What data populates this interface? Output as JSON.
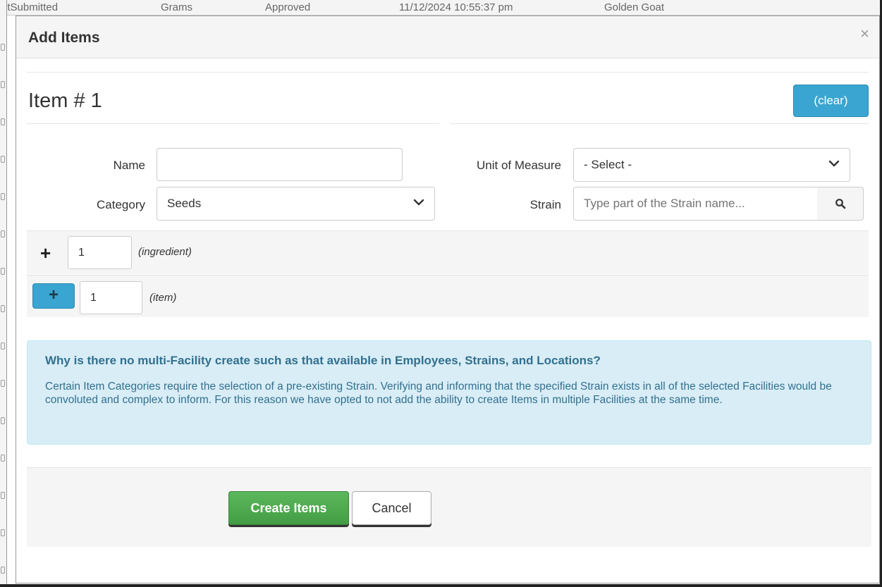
{
  "background": {
    "columns": [
      "otSubmitted",
      "Grams",
      "Approved",
      "11/12/2024 10:55:37 pm",
      "Golden Goat"
    ]
  },
  "modal": {
    "title": "Add Items",
    "close_glyph": "×"
  },
  "item": {
    "heading": "Item # 1",
    "clear_label": "(clear)",
    "name_label": "Name",
    "name_value": "",
    "category_label": "Category",
    "category_value": "Seeds",
    "uom_label": "Unit of Measure",
    "uom_value": "- Select -",
    "strain_label": "Strain",
    "strain_placeholder": "Type part of the Strain name..."
  },
  "ingredient_row": {
    "plus_glyph": "+",
    "count": "1",
    "hint": "(ingredient)"
  },
  "item_row": {
    "plus_glyph": "+",
    "count": "1",
    "hint": "(item)"
  },
  "info": {
    "title": "Why is there no multi-Facility create such as that available in Employees, Strains, and Locations?",
    "body": "Certain Item Categories require the selection of a pre-existing Strain. Verifying and informing that the specified Strain exists in all of the selected Facilities would be convoluted and complex to inform. For this reason we have opted to not add the ability to create Items in multiple Facilities at the same time."
  },
  "footer": {
    "create_label": "Create Items",
    "cancel_label": "Cancel"
  },
  "icons": {
    "search": "search-icon",
    "chevron": "chevron-down-icon",
    "close": "close-icon"
  },
  "colors": {
    "info_bg": "#d9edf7",
    "info_text": "#31708f",
    "primary_blue": "#3aa5d1",
    "success_green": "#5cb85c"
  }
}
